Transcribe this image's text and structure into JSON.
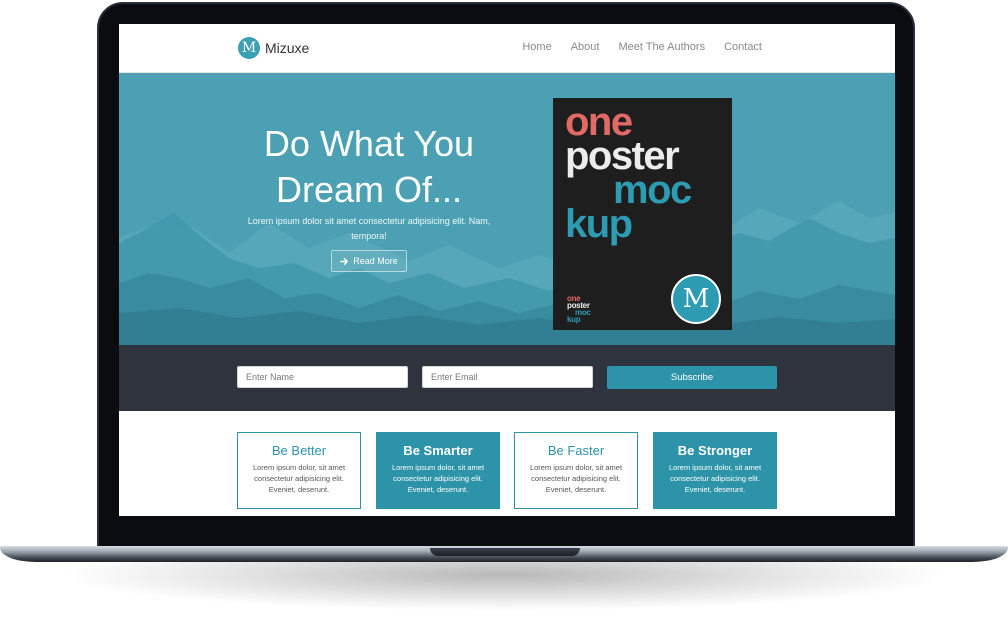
{
  "brand": {
    "name": "Mizuxe",
    "logo_letter": "M"
  },
  "nav": {
    "links": [
      {
        "label": "Home"
      },
      {
        "label": "About"
      },
      {
        "label": "Meet The Authors"
      },
      {
        "label": "Contact"
      }
    ]
  },
  "hero": {
    "title": "Do What You Dream Of...",
    "text": "Lorem ipsum dolor sit amet consectetur adipisicing elit. Nam, tempora!",
    "button_icon": "arrow-right-icon",
    "button_label": "Read More"
  },
  "poster": {
    "words": [
      "one",
      "poster",
      "moc",
      "kup"
    ],
    "small_words": [
      "one",
      "poster",
      "moc",
      "kup"
    ],
    "badge_letter": "M"
  },
  "subscribe": {
    "name_placeholder": "Enter Name",
    "email_placeholder": "Enter Email",
    "button_label": "Subscribe"
  },
  "features": [
    {
      "title": "Be Better",
      "text": "Lorem ipsum dolor, sit amet consectetur adipisicing elit. Eveniet, deserunt."
    },
    {
      "title": "Be Smarter",
      "text": "Lorem ipsum dolor, sit amet consectetur adipisicing elit. Eveniet, deserunt."
    },
    {
      "title": "Be Faster",
      "text": "Lorem ipsum dolor, sit amet consectetur adipisicing elit. Eveniet, deserunt."
    },
    {
      "title": "Be Stronger",
      "text": "Lorem ipsum dolor, sit amet consectetur adipisicing elit. Eveniet, deserunt."
    }
  ],
  "colors": {
    "accent": "#2d93a8",
    "hero_bg": "#4ba1b3",
    "subscribe_bg": "#2e333d",
    "poster_red": "#e26a66"
  }
}
